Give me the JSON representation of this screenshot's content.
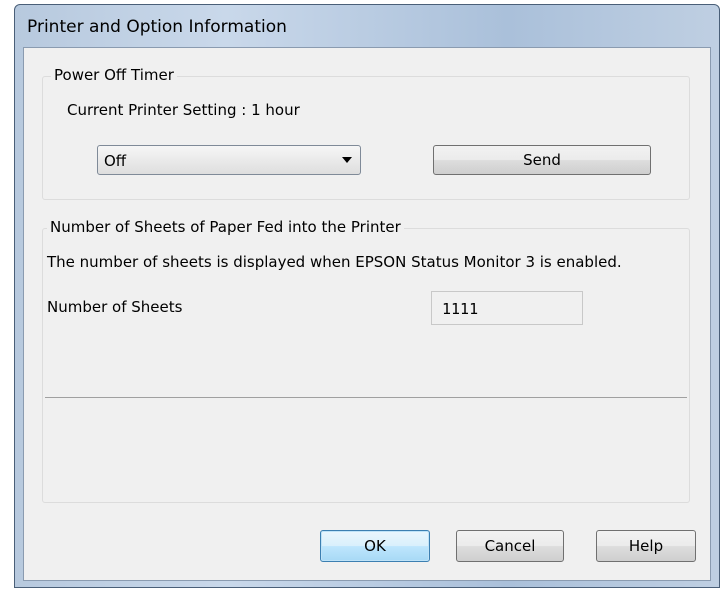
{
  "window": {
    "title": "Printer and Option Information"
  },
  "power_off_timer": {
    "legend": "Power Off Timer",
    "current_setting": "Current Printer Setting : 1 hour",
    "selected": "Off",
    "send_label": "Send"
  },
  "sheets": {
    "legend": "Number of Sheets of Paper Fed into the Printer",
    "note": "The number of sheets is displayed when EPSON Status Monitor 3 is enabled.",
    "count_label": "Number of Sheets",
    "count_value": "1111"
  },
  "buttons": {
    "ok": "OK",
    "cancel": "Cancel",
    "help": "Help"
  }
}
